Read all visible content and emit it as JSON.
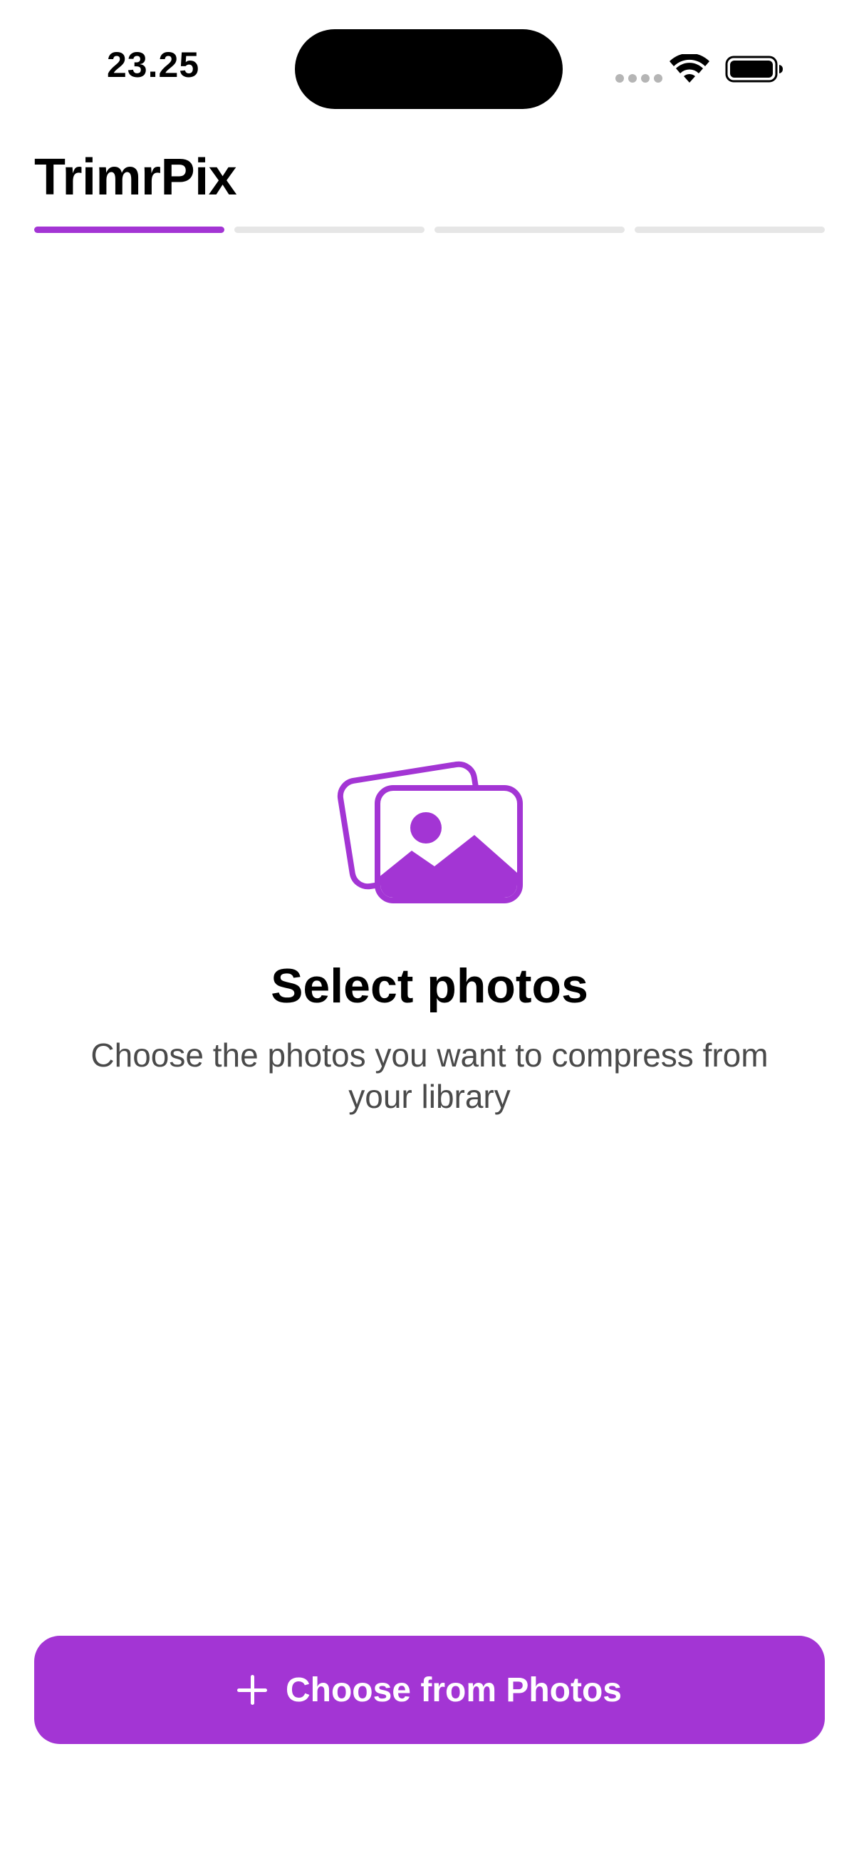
{
  "status_bar": {
    "time": "23.25",
    "icons": [
      "signal-dots-icon",
      "wifi-icon",
      "battery-icon"
    ]
  },
  "header": {
    "title": "TrimrPix",
    "steps_total": 4,
    "current_step": 1
  },
  "empty_state": {
    "icon": "photos-stack-icon",
    "title": "Select photos",
    "subtitle": "Choose the photos you want to compress from your library"
  },
  "cta": {
    "icon": "plus-icon",
    "label": "Choose from Photos"
  },
  "colors": {
    "accent": "#a335d4",
    "inactive_step": "#e6e6e6",
    "subtitle_text": "#4a4a4a",
    "background": "#ffffff"
  }
}
